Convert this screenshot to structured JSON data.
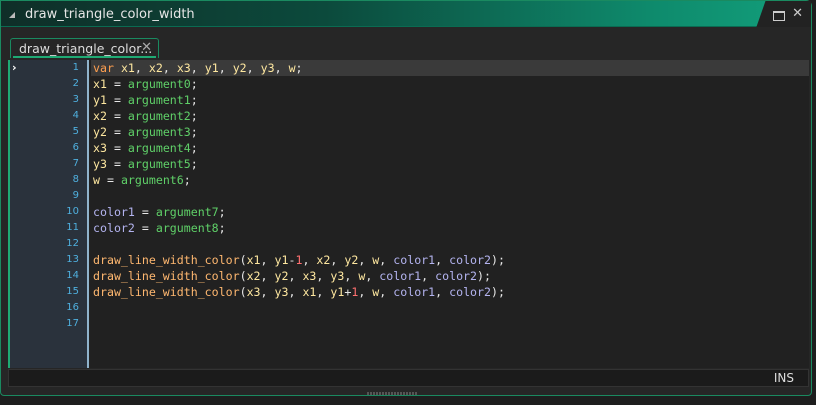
{
  "window": {
    "title": "draw_triangle_color_width",
    "maximize_icon": "maximize-icon",
    "close_icon": "close-icon"
  },
  "tab": {
    "label": "draw_triangle_color...",
    "close": "✕"
  },
  "gutter": {
    "arrow": "›"
  },
  "colors": {
    "accent": "#1faa74",
    "line_numbers": "#4fb0df"
  },
  "lines": [
    [
      [
        "var",
        "kw"
      ],
      [
        " ",
        "p"
      ],
      [
        "x1",
        "var"
      ],
      [
        ", ",
        "p"
      ],
      [
        "x2",
        "var"
      ],
      [
        ", ",
        "p"
      ],
      [
        "x3",
        "var"
      ],
      [
        ", ",
        "p"
      ],
      [
        "y1",
        "var"
      ],
      [
        ", ",
        "p"
      ],
      [
        "y2",
        "var"
      ],
      [
        ", ",
        "p"
      ],
      [
        "y3",
        "var"
      ],
      [
        ", ",
        "p"
      ],
      [
        "w",
        "var"
      ],
      [
        ";",
        "p"
      ]
    ],
    [
      [
        "x1",
        "var"
      ],
      [
        " = ",
        "p"
      ],
      [
        "argument0",
        "arg"
      ],
      [
        ";",
        "p"
      ]
    ],
    [
      [
        "y1",
        "var"
      ],
      [
        " = ",
        "p"
      ],
      [
        "argument1",
        "arg"
      ],
      [
        ";",
        "p"
      ]
    ],
    [
      [
        "x2",
        "var"
      ],
      [
        " = ",
        "p"
      ],
      [
        "argument2",
        "arg"
      ],
      [
        ";",
        "p"
      ]
    ],
    [
      [
        "y2",
        "var"
      ],
      [
        " = ",
        "p"
      ],
      [
        "argument3",
        "arg"
      ],
      [
        ";",
        "p"
      ]
    ],
    [
      [
        "x3",
        "var"
      ],
      [
        " = ",
        "p"
      ],
      [
        "argument4",
        "arg"
      ],
      [
        ";",
        "p"
      ]
    ],
    [
      [
        "y3",
        "var"
      ],
      [
        " = ",
        "p"
      ],
      [
        "argument5",
        "arg"
      ],
      [
        ";",
        "p"
      ]
    ],
    [
      [
        "w",
        "var"
      ],
      [
        " = ",
        "p"
      ],
      [
        "argument6",
        "arg"
      ],
      [
        ";",
        "p"
      ]
    ],
    [],
    [
      [
        "color1",
        "loc"
      ],
      [
        " = ",
        "p"
      ],
      [
        "argument7",
        "arg"
      ],
      [
        ";",
        "p"
      ]
    ],
    [
      [
        "color2",
        "loc"
      ],
      [
        " = ",
        "p"
      ],
      [
        "argument8",
        "arg"
      ],
      [
        ";",
        "p"
      ]
    ],
    [],
    [
      [
        "draw_line_width_color",
        "fn"
      ],
      [
        "(",
        "p"
      ],
      [
        "x1",
        "var"
      ],
      [
        ", ",
        "p"
      ],
      [
        "y1",
        "var"
      ],
      [
        "-",
        "p"
      ],
      [
        "1",
        "num"
      ],
      [
        ", ",
        "p"
      ],
      [
        "x2",
        "var"
      ],
      [
        ", ",
        "p"
      ],
      [
        "y2",
        "var"
      ],
      [
        ", ",
        "p"
      ],
      [
        "w",
        "var"
      ],
      [
        ", ",
        "p"
      ],
      [
        "color1",
        "loc"
      ],
      [
        ", ",
        "p"
      ],
      [
        "color2",
        "loc"
      ],
      [
        ");",
        "p"
      ]
    ],
    [
      [
        "draw_line_width_color",
        "fn"
      ],
      [
        "(",
        "p"
      ],
      [
        "x2",
        "var"
      ],
      [
        ", ",
        "p"
      ],
      [
        "y2",
        "var"
      ],
      [
        ", ",
        "p"
      ],
      [
        "x3",
        "var"
      ],
      [
        ", ",
        "p"
      ],
      [
        "y3",
        "var"
      ],
      [
        ", ",
        "p"
      ],
      [
        "w",
        "var"
      ],
      [
        ", ",
        "p"
      ],
      [
        "color1",
        "loc"
      ],
      [
        ", ",
        "p"
      ],
      [
        "color2",
        "loc"
      ],
      [
        ");",
        "p"
      ]
    ],
    [
      [
        "draw_line_width_color",
        "fn"
      ],
      [
        "(",
        "p"
      ],
      [
        "x3",
        "var"
      ],
      [
        ", ",
        "p"
      ],
      [
        "y3",
        "var"
      ],
      [
        ", ",
        "p"
      ],
      [
        "x1",
        "var"
      ],
      [
        ", ",
        "p"
      ],
      [
        "y1",
        "var"
      ],
      [
        "+",
        "p"
      ],
      [
        "1",
        "num"
      ],
      [
        ", ",
        "p"
      ],
      [
        "w",
        "var"
      ],
      [
        ", ",
        "p"
      ],
      [
        "color1",
        "loc"
      ],
      [
        ", ",
        "p"
      ],
      [
        "color2",
        "loc"
      ],
      [
        ");",
        "p"
      ]
    ],
    [],
    []
  ],
  "line_numbers": [
    "1",
    "2",
    "3",
    "4",
    "5",
    "6",
    "7",
    "8",
    "9",
    "10",
    "11",
    "12",
    "13",
    "14",
    "15",
    "16",
    "17"
  ],
  "status": {
    "mode": "INS"
  }
}
